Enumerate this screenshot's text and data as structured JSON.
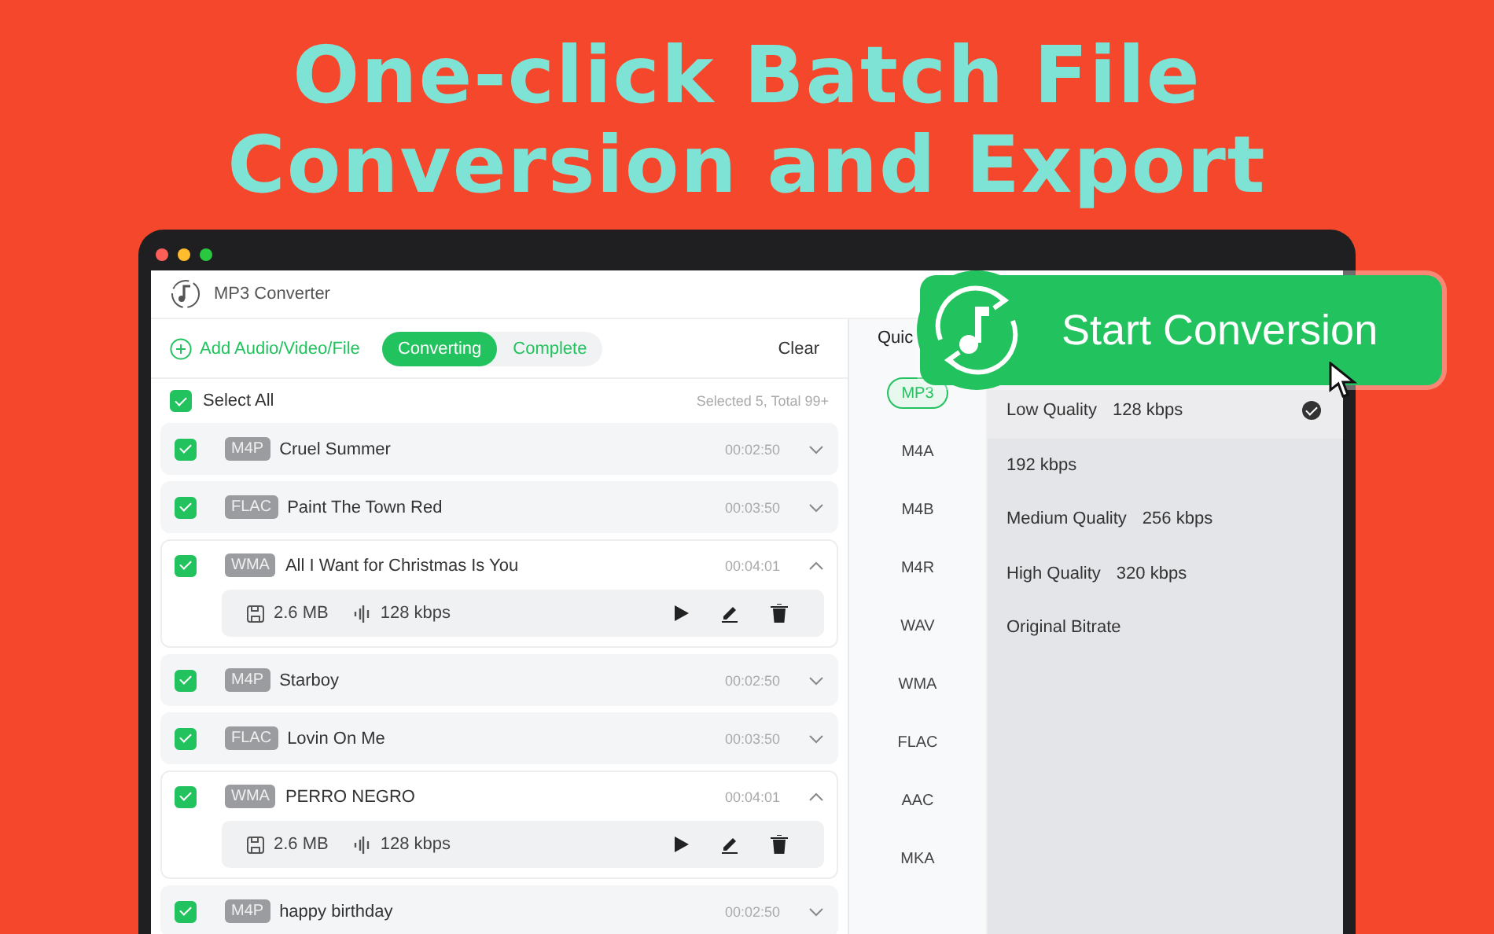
{
  "headline": [
    "One-click Batch File",
    "Conversion and Export"
  ],
  "window": {
    "title": "MP3 Converter"
  },
  "toolbar": {
    "add_label": "Add Audio/Video/File",
    "tabs": [
      {
        "label": "Converting",
        "selected": true
      },
      {
        "label": "Complete",
        "selected": false
      }
    ],
    "clear_label": "Clear"
  },
  "select_all": {
    "label": "Select All",
    "checked": true,
    "summary": "Selected 5,  Total 99+"
  },
  "files": [
    {
      "format": "M4P",
      "name": "Cruel Summer",
      "duration": "00:02:50",
      "checked": true,
      "expanded": false
    },
    {
      "format": "FLAC",
      "name": "Paint The Town Red",
      "duration": "00:03:50",
      "checked": true,
      "expanded": false
    },
    {
      "format": "WMA",
      "name": "All I Want for Christmas Is You",
      "duration": "00:04:01",
      "checked": true,
      "expanded": true,
      "size": "2.6 MB",
      "bitrate": "128 kbps"
    },
    {
      "format": "M4P",
      "name": "Starboy",
      "duration": "00:02:50",
      "checked": true,
      "expanded": false
    },
    {
      "format": "FLAC",
      "name": "Lovin On Me",
      "duration": "00:03:50",
      "checked": true,
      "expanded": false
    },
    {
      "format": "WMA",
      "name": "PERRO NEGRO",
      "duration": "00:04:01",
      "checked": true,
      "expanded": true,
      "size": "2.6 MB",
      "bitrate": "128 kbps"
    },
    {
      "format": "M4P",
      "name": "happy birthday",
      "duration": "00:02:50",
      "checked": true,
      "expanded": false
    }
  ],
  "settings_tab": "Quic",
  "formats": [
    {
      "label": "MP3",
      "selected": true
    },
    {
      "label": "M4A",
      "selected": false
    },
    {
      "label": "M4B",
      "selected": false
    },
    {
      "label": "M4R",
      "selected": false
    },
    {
      "label": "WAV",
      "selected": false
    },
    {
      "label": "WMA",
      "selected": false
    },
    {
      "label": "FLAC",
      "selected": false
    },
    {
      "label": "AAC",
      "selected": false
    },
    {
      "label": "MKA",
      "selected": false
    }
  ],
  "qualities": [
    {
      "label": "Low Quality",
      "bitrate": "128 kbps",
      "selected": true
    },
    {
      "label": "192 kbps",
      "selected": false
    },
    {
      "label": "Medium Quality",
      "bitrate": "256 kbps",
      "selected": false
    },
    {
      "label": "High Quality",
      "bitrate": "320 kbps",
      "selected": false
    },
    {
      "label": "Original Bitrate",
      "selected": false
    }
  ],
  "start_button": "Start Conversion"
}
